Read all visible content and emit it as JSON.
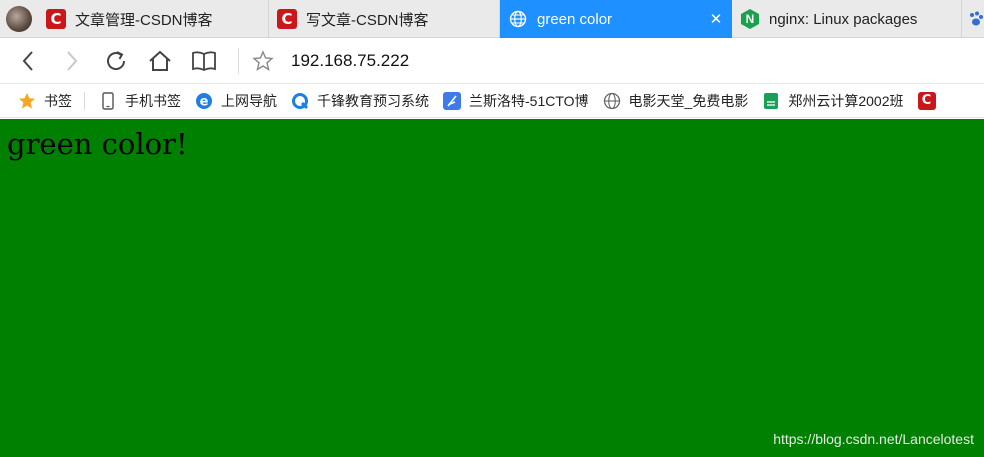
{
  "tabs": [
    {
      "label": "文章管理-CSDN博客",
      "icon": "csdn-icon",
      "active": false
    },
    {
      "label": "写文章-CSDN博客",
      "icon": "csdn-icon",
      "active": false
    },
    {
      "label": "green color",
      "icon": "globe-icon",
      "active": true
    },
    {
      "label": "nginx: Linux packages",
      "icon": "nginx-icon",
      "active": false
    }
  ],
  "csdn_letter": "C",
  "nginx_letter": "N",
  "tab_close_glyph": "✕",
  "address": {
    "url": "192.168.75.222"
  },
  "bookmarks": [
    {
      "label": "书签",
      "icon": "star-icon"
    },
    {
      "label": "手机书签",
      "icon": "phone-icon"
    },
    {
      "label": "上网导航",
      "icon": "ie-icon"
    },
    {
      "label": "千锋教育预习系统",
      "icon": "qianfeng-icon"
    },
    {
      "label": "兰斯洛特-51CTO博",
      "icon": "feather-icon"
    },
    {
      "label": "电影天堂_免费电影",
      "icon": "globe-icon"
    },
    {
      "label": "郑州云计算2002班",
      "icon": "sheet-icon"
    }
  ],
  "content": {
    "text": "green color!",
    "background_color": "#008000"
  },
  "watermark": "https://blog.csdn.net/Lancelotest",
  "colors": {
    "active_tab": "#1e90ff",
    "csdn_red": "#c9171c",
    "nginx_green": "#1ba14e"
  }
}
